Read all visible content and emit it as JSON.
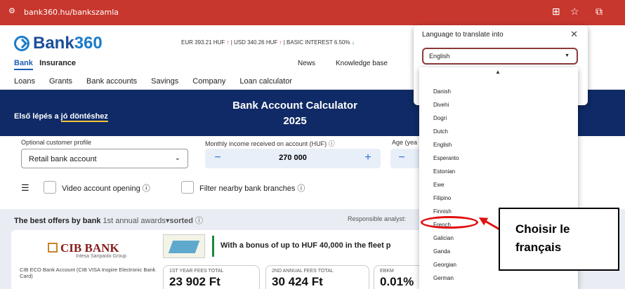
{
  "browser": {
    "url": "bank360.hu/bankszamla",
    "icons": [
      "tune-icon",
      "translate-icon",
      "star-icon",
      "extensions-icon"
    ]
  },
  "header": {
    "logo_text": "Bank",
    "logo_num": "360",
    "rates": {
      "eur": "EUR  393.21 HUF",
      "usd": "USD  340.26 HUF",
      "basic": "BASIC INTEREST  6.50%"
    }
  },
  "nav": {
    "primary": [
      "Bank",
      "Insurance"
    ],
    "right": [
      "News",
      "Knowledge base"
    ],
    "secondary": [
      "Loans",
      "Grants",
      "Bank accounts",
      "Savings",
      "Company",
      "Loan calculator"
    ]
  },
  "hero": {
    "tagline_prefix": "Első lépés a ",
    "tagline_underline": "jó döntéshez",
    "title_line1": "Bank Account Calculator",
    "title_line2": "2025"
  },
  "calc": {
    "profile_label": "Optional customer profile",
    "profile_value": "Retail bank account",
    "income_label": "Monthly income received on account (HUF)",
    "income_value": "270 000",
    "age_label": "Age (yea",
    "video_label": "Video account opening",
    "filter_label": "Filter nearby bank branches"
  },
  "offers": {
    "heading": "The best offers by bank",
    "sort_text": "1st annual awards",
    "sorted": "sorted",
    "analyst": "Responsible analyst:",
    "bank_name": "CIB BANK",
    "bank_sub": "Intesa Sanpaolo Group",
    "card_info": "CIB ECO Bank Account (CIB VISA Inspire Electronic Bank Card)",
    "promo": "With a bonus of up to HUF 40,000 in the fleet p",
    "fees": [
      {
        "label": "1ST YEAR FEES TOTAL",
        "value": "23 902 Ft"
      },
      {
        "label": "2ND ANNUAL FEES TOTAL",
        "value": "30 424 Ft"
      },
      {
        "label": "EBKM",
        "value": "0.01%"
      }
    ]
  },
  "translate": {
    "title": "Language to translate into",
    "selected": "English",
    "options": [
      "Danish",
      "Divehi",
      "Dogri",
      "Dutch",
      "English",
      "Esperanto",
      "Estonian",
      "Ewe",
      "Filipino",
      "Finnish",
      "French",
      "Galician",
      "Ganda",
      "Georgian",
      "German"
    ]
  },
  "annotation": {
    "line1": "Choisir le",
    "line2": "français",
    "color": "#e01010"
  }
}
